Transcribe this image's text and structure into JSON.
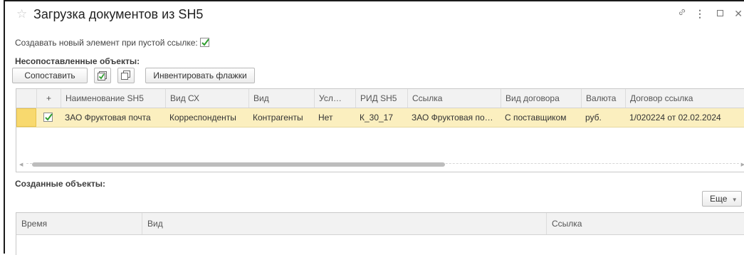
{
  "window": {
    "title": "Загрузка документов из SH5",
    "icons": [
      "star-icon",
      "link-icon",
      "more-icon",
      "maximize-icon",
      "close-icon"
    ]
  },
  "options": {
    "create_new_label": "Создавать новый элемент при пустой ссылке:",
    "create_new_checked": true
  },
  "unmatched": {
    "heading": "Несопоставленные объекты:",
    "toolbar": {
      "match_label": "Сопоставить",
      "invert_label": "Инвентировать флажки"
    },
    "columns": [
      "+",
      "Наименование SH5",
      "Вид СХ",
      "Вид",
      "Усл…",
      "РИД SH5",
      "Ссылка",
      "Вид договора",
      "Валюта",
      "Договор ссылка"
    ],
    "rows": [
      {
        "checked": true,
        "name": "ЗАО Фруктовая почта",
        "vid_sh": "Корреспонденты",
        "vid": "Контрагенты",
        "usl": "Нет",
        "rid": "К_30_17",
        "link": "ЗАО Фруктовая по…",
        "contract_type": "С поставщиком",
        "currency": "руб.",
        "contract_link": "1/020224 от 02.02.2024"
      }
    ]
  },
  "created": {
    "heading": "Созданные объекты:",
    "more_label": "Еще",
    "columns": [
      "Время",
      "Вид",
      "Ссылка"
    ]
  },
  "colors": {
    "selected_row": "#fbefbf",
    "selected_cell": "#f8d96e",
    "checkmark": "#2e9e2e"
  }
}
